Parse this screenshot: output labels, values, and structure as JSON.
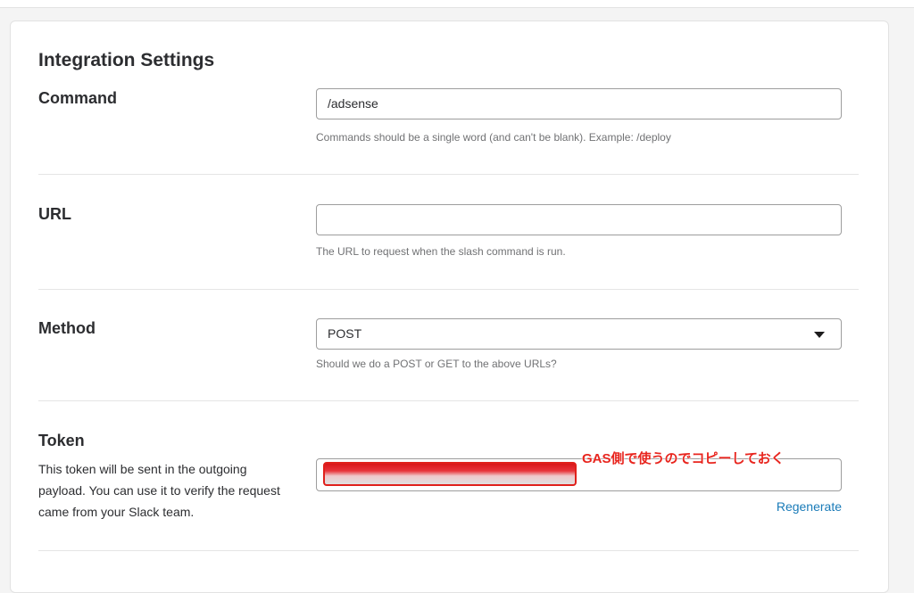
{
  "section_title": "Integration Settings",
  "command": {
    "label": "Command",
    "value": "/adsense",
    "help": "Commands should be a single word (and can't be blank). Example: /deploy"
  },
  "url": {
    "label": "URL",
    "value": "",
    "help": "The URL to request when the slash command is run."
  },
  "method": {
    "label": "Method",
    "selected": "POST",
    "help": "Should we do a POST or GET to the above URLs?"
  },
  "token": {
    "label": "Token",
    "description": "This token will be sent in the outgoing payload. You can use it to verify the request came from your Slack team.",
    "annotation": "GAS側で使うのでコピーしておく",
    "regenerate_label": "Regenerate"
  },
  "colors": {
    "link": "#1a7bb8",
    "annotation": "#e8251e"
  }
}
